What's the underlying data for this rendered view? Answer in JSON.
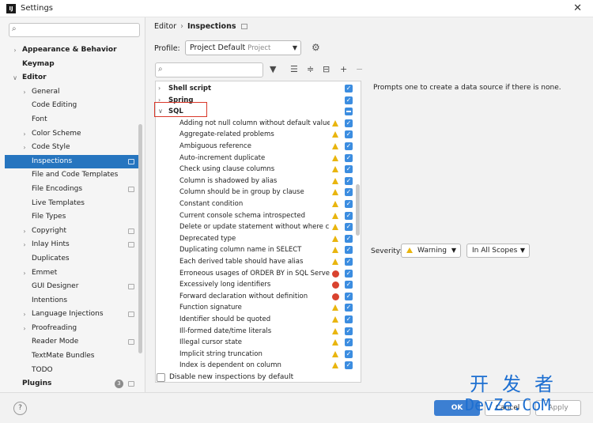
{
  "window": {
    "title": "Settings",
    "app_icon": "IJ"
  },
  "sidebar": {
    "search_icon": "search-icon",
    "items": [
      {
        "label": "Appearance & Behavior",
        "level": 0,
        "bold": true,
        "expandable": true,
        "expanded": false
      },
      {
        "label": "Keymap",
        "level": 0,
        "bold": true
      },
      {
        "label": "Editor",
        "level": 0,
        "bold": true,
        "expandable": true,
        "expanded": true
      },
      {
        "label": "General",
        "level": 1,
        "expandable": true,
        "expanded": false
      },
      {
        "label": "Code Editing",
        "level": 1
      },
      {
        "label": "Font",
        "level": 1
      },
      {
        "label": "Color Scheme",
        "level": 1,
        "expandable": true,
        "expanded": false
      },
      {
        "label": "Code Style",
        "level": 1,
        "expandable": true,
        "expanded": false
      },
      {
        "label": "Inspections",
        "level": 1,
        "selected": true,
        "page_icon": true
      },
      {
        "label": "File and Code Templates",
        "level": 1
      },
      {
        "label": "File Encodings",
        "level": 1,
        "page_icon": true
      },
      {
        "label": "Live Templates",
        "level": 1
      },
      {
        "label": "File Types",
        "level": 1
      },
      {
        "label": "Copyright",
        "level": 1,
        "expandable": true,
        "expanded": false,
        "page_icon": true
      },
      {
        "label": "Inlay Hints",
        "level": 1,
        "expandable": true,
        "expanded": false,
        "page_icon": true
      },
      {
        "label": "Duplicates",
        "level": 1
      },
      {
        "label": "Emmet",
        "level": 1,
        "expandable": true,
        "expanded": false
      },
      {
        "label": "GUI Designer",
        "level": 1,
        "page_icon": true
      },
      {
        "label": "Intentions",
        "level": 1
      },
      {
        "label": "Language Injections",
        "level": 1,
        "expandable": true,
        "expanded": false,
        "page_icon": true
      },
      {
        "label": "Proofreading",
        "level": 1,
        "expandable": true,
        "expanded": false
      },
      {
        "label": "Reader Mode",
        "level": 1,
        "page_icon": true
      },
      {
        "label": "TextMate Bundles",
        "level": 1
      },
      {
        "label": "TODO",
        "level": 1
      },
      {
        "label": "Plugins",
        "level": 0,
        "bold": true,
        "badge": "3",
        "page_icon": true
      }
    ]
  },
  "breadcrumb": {
    "parent": "Editor",
    "separator": "›",
    "current": "Inspections"
  },
  "profile": {
    "label": "Profile:",
    "value": "Project Default",
    "sub": "Project"
  },
  "toolbar": {
    "filter_icon": "filter-icon",
    "expand_icon": "expand-all-icon",
    "collapse_icon": "collapse-all-icon",
    "reset_icon": "reset-icon",
    "add_icon": "add-icon",
    "remove_icon": "remove-icon"
  },
  "inspections": [
    {
      "name": "Shell script",
      "group": true,
      "expanded": false,
      "state": "checked"
    },
    {
      "name": "Spring",
      "group": true,
      "expanded": false,
      "state": "checked"
    },
    {
      "name": "SQL",
      "group": true,
      "expanded": true,
      "state": "mixed"
    },
    {
      "name": "Adding not null column without default value",
      "severity": "warning",
      "state": "checked"
    },
    {
      "name": "Aggregate-related problems",
      "severity": "warning",
      "state": "checked"
    },
    {
      "name": "Ambiguous reference",
      "severity": "warning",
      "state": "checked"
    },
    {
      "name": "Auto-increment duplicate",
      "severity": "warning",
      "state": "checked"
    },
    {
      "name": "Check using clause columns",
      "severity": "warning",
      "state": "checked"
    },
    {
      "name": "Column is shadowed by alias",
      "severity": "warning",
      "state": "checked"
    },
    {
      "name": "Column should be in group by clause",
      "severity": "warning",
      "state": "checked"
    },
    {
      "name": "Constant condition",
      "severity": "warning",
      "state": "checked"
    },
    {
      "name": "Current console schema introspected",
      "severity": "warning",
      "state": "checked"
    },
    {
      "name": "Delete or update statement without where clauses",
      "severity": "warning",
      "state": "checked"
    },
    {
      "name": "Deprecated type",
      "severity": "warning",
      "state": "checked"
    },
    {
      "name": "Duplicating column name in SELECT",
      "severity": "warning",
      "state": "checked"
    },
    {
      "name": "Each derived table should have alias",
      "severity": "warning",
      "state": "checked"
    },
    {
      "name": "Erroneous usages of ORDER BY in SQL Server code",
      "severity": "error",
      "state": "checked"
    },
    {
      "name": "Excessively long identifiers",
      "severity": "error",
      "state": "checked"
    },
    {
      "name": "Forward declaration without definition",
      "severity": "error",
      "state": "checked"
    },
    {
      "name": "Function signature",
      "severity": "warning",
      "state": "checked"
    },
    {
      "name": "Identifier should be quoted",
      "severity": "warning",
      "state": "checked"
    },
    {
      "name": "Ill-formed date/time literals",
      "severity": "warning",
      "state": "checked"
    },
    {
      "name": "Illegal cursor state",
      "severity": "warning",
      "state": "checked"
    },
    {
      "name": "Implicit string truncation",
      "severity": "warning",
      "state": "checked"
    },
    {
      "name": "Index is dependent on column",
      "severity": "warning",
      "state": "checked"
    }
  ],
  "description": "Prompts one to create a data source if there is none.",
  "severity": {
    "label": "Severity:",
    "value": "Warning",
    "scope": "In All Scopes"
  },
  "disable_new": {
    "label": "Disable new inspections by default"
  },
  "buttons": {
    "help": "?",
    "ok": "OK",
    "cancel": "Cancel",
    "apply": "Apply"
  },
  "watermark": {
    "top": "开发者",
    "bottom": "DevZe.CoM"
  },
  "colors": {
    "accent": "#2675bf",
    "highlight": "#d9382a",
    "warning": "#e9b50e",
    "error": "#d9432f",
    "checkbox": "#3c8de0"
  }
}
